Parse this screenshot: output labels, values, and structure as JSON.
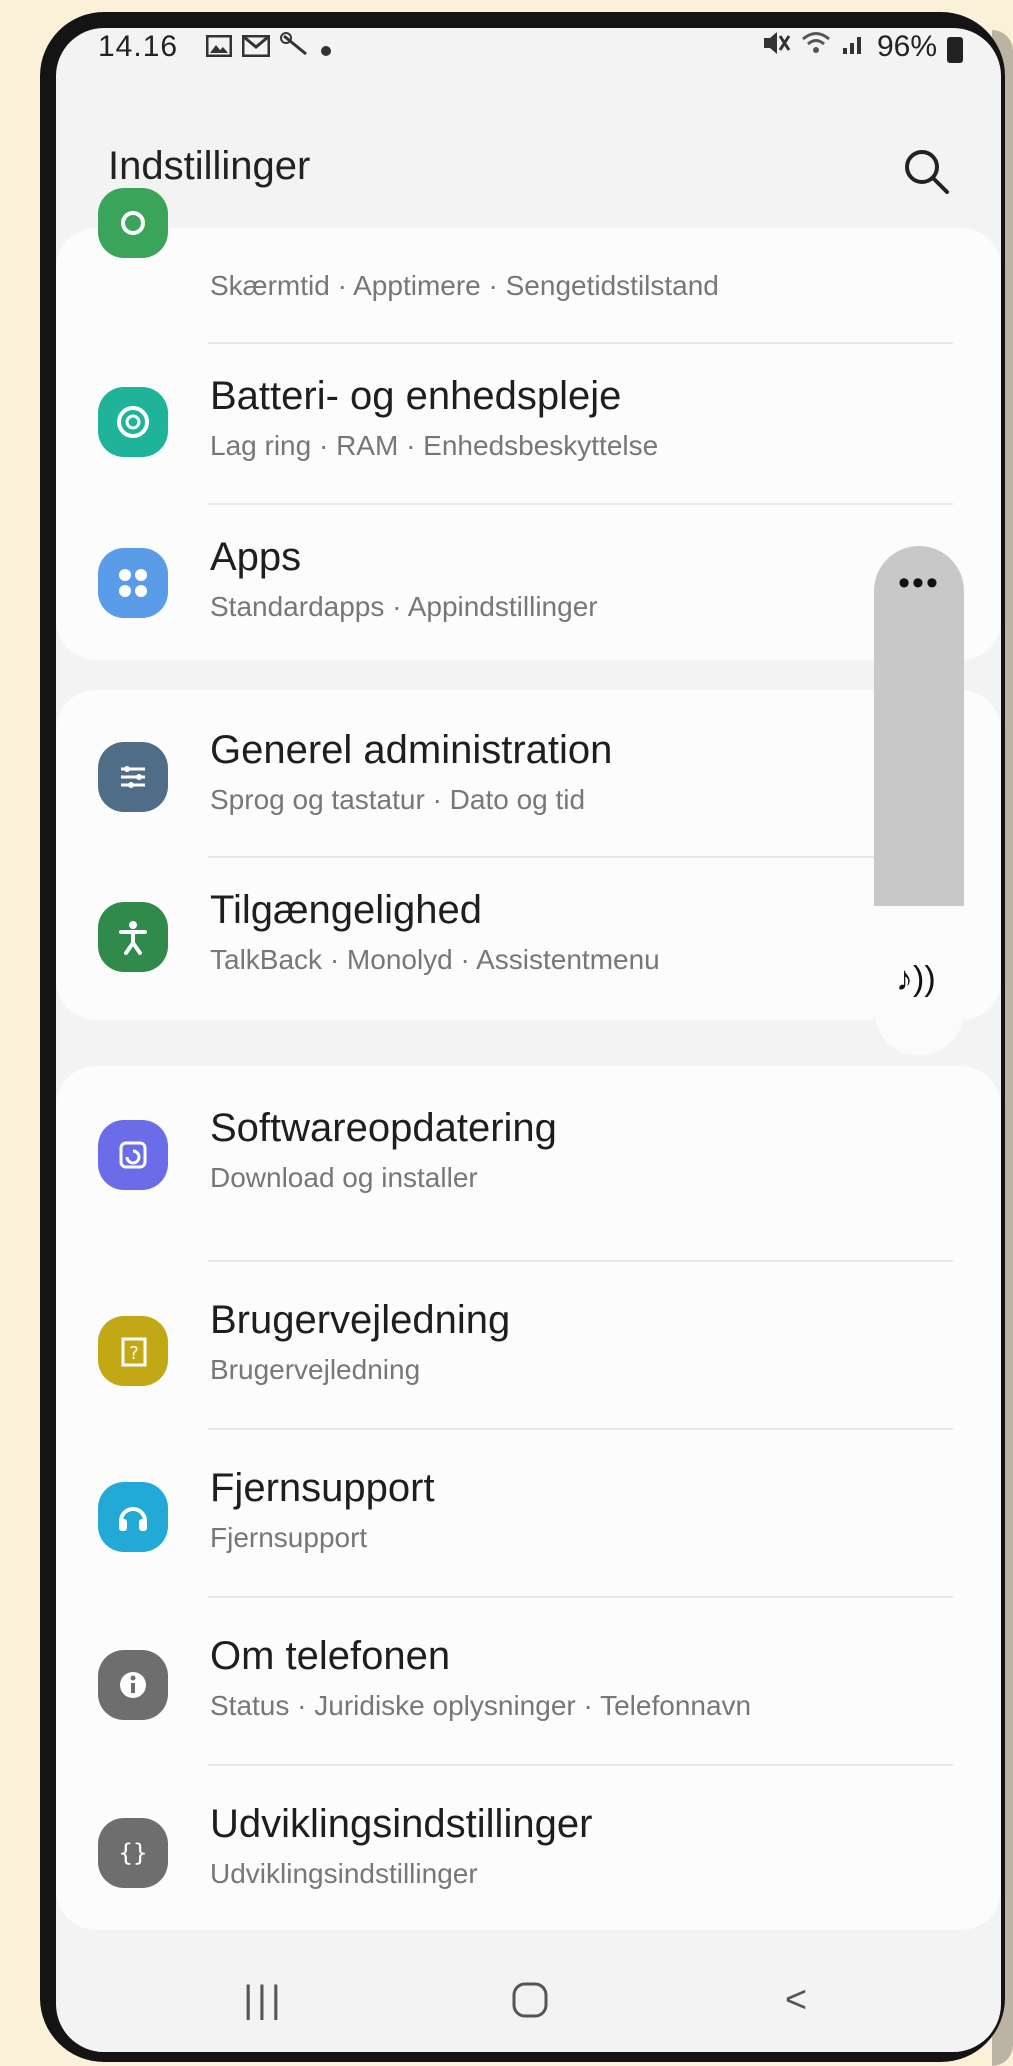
{
  "status_bar": {
    "time": "14.16",
    "battery": "96%",
    "icons_left": [
      "gallery-icon",
      "gmail-icon",
      "tools-icon",
      "dot-icon"
    ],
    "icons_right": [
      "mute-icon",
      "wifi-icon",
      "signal-icon",
      "battery-icon"
    ]
  },
  "header": {
    "title": "Indstillinger",
    "search_icon": "search-icon"
  },
  "items": [
    {
      "title": "",
      "subtitle": "Skærmtid · Apptimere · Sengetidstilstand",
      "icon": "digital-wellbeing-icon",
      "color": "#3aa55a"
    },
    {
      "title": "Batteri- og enhedspleje",
      "subtitle": "Lag ring · RAM · Enhedsbeskyttelse",
      "icon": "device-care-icon",
      "color": "#1fb39a"
    },
    {
      "title": "Apps",
      "subtitle": "Standardapps · Appindstillinger",
      "icon": "apps-icon",
      "color": "#5a9ce8"
    },
    {
      "title": "Generel administration",
      "subtitle": "Sprog og tastatur · Dato og tid",
      "icon": "sliders-icon",
      "color": "#4f6d86"
    },
    {
      "title": "Tilgængelighed",
      "subtitle": "TalkBack · Monolyd · Assistentmenu",
      "icon": "accessibility-icon",
      "color": "#2f8a4c"
    },
    {
      "title": "Softwareopdatering",
      "subtitle": "Download og installer",
      "icon": "software-update-icon",
      "color": "#6b6de8"
    },
    {
      "title": "Brugervejledning",
      "subtitle": "Brugervejledning",
      "icon": "user-manual-icon",
      "color": "#c2a814"
    },
    {
      "title": "Fjernsupport",
      "subtitle": "Fjernsupport",
      "icon": "headset-icon",
      "color": "#22a9d6"
    },
    {
      "title": "Om telefonen",
      "subtitle": "Status · Juridiske oplysninger · Telefonnavn",
      "icon": "info-icon",
      "color": "#6e6e6e"
    },
    {
      "title": "Udviklingsindstillinger",
      "subtitle": "Udviklingsindstillinger",
      "icon": "developer-options-icon",
      "color": "#6e6e6e"
    }
  ],
  "floating_panel": {
    "more_label": "•••",
    "sound_icon": "music-note-icon",
    "sound_glyph": "♪))"
  },
  "nav_bar": {
    "recents_glyph": "|||",
    "home_glyph": "○",
    "back_glyph": "<"
  }
}
